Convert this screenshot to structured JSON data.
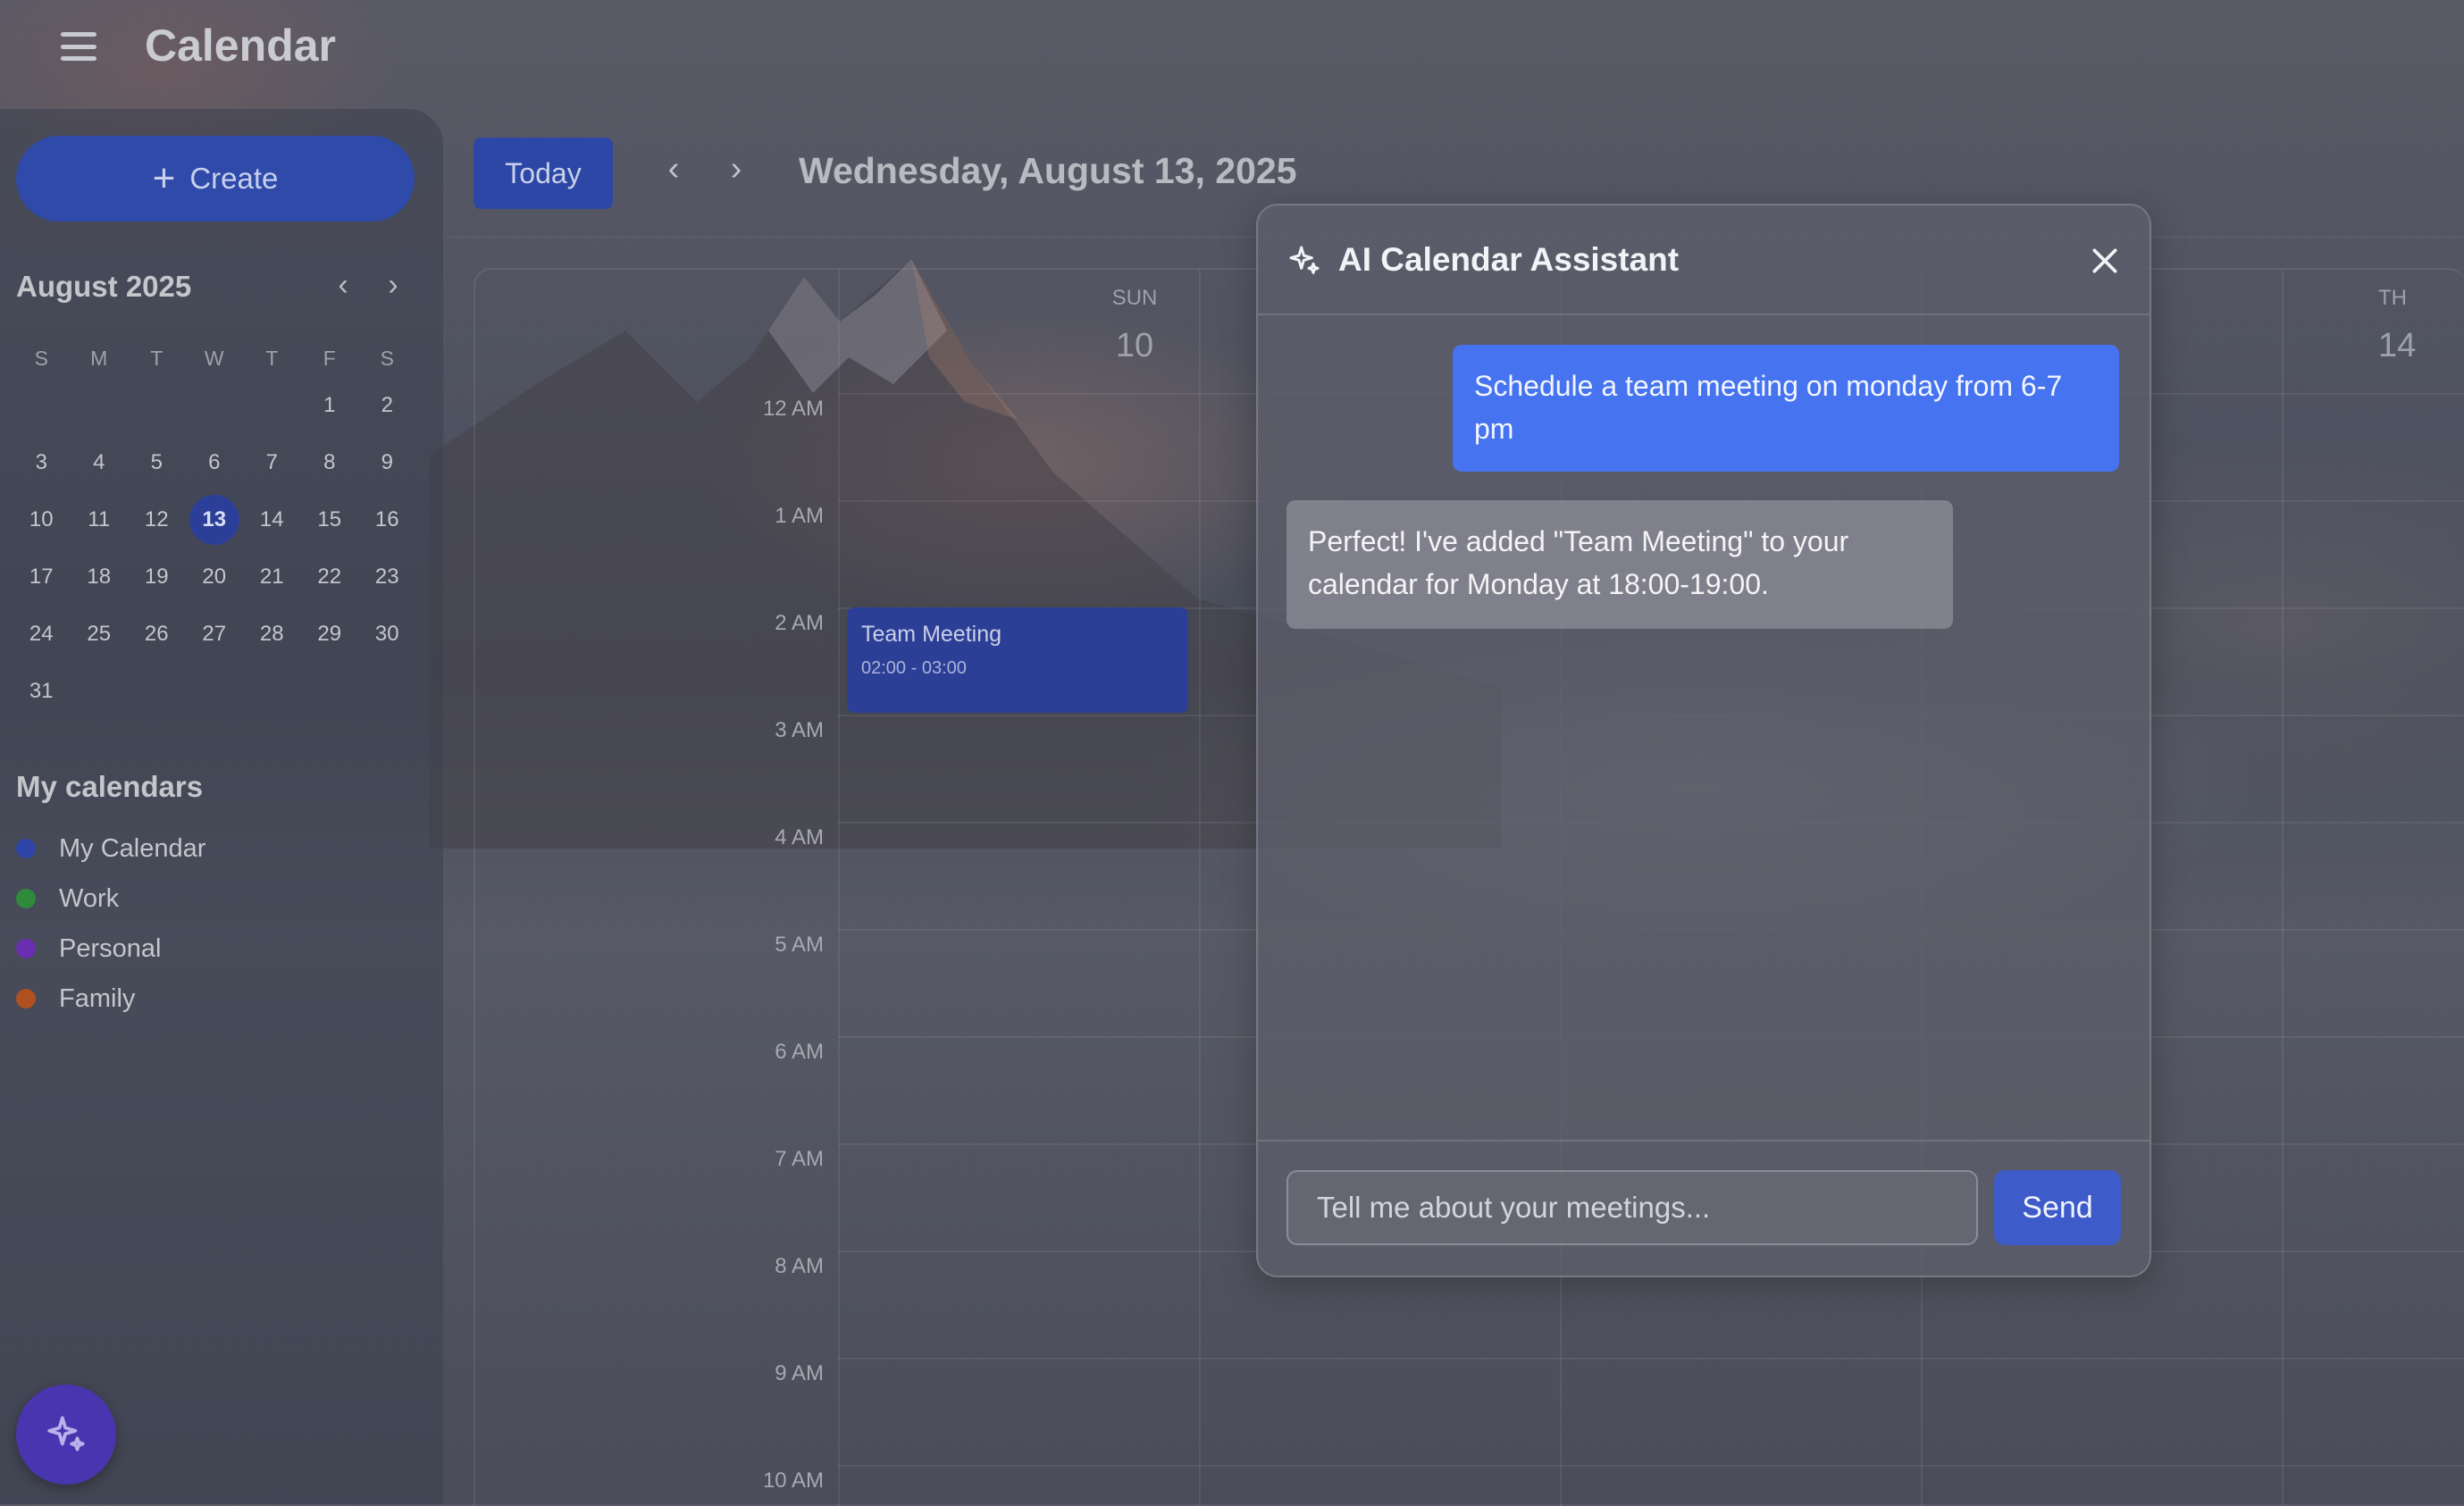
{
  "app": {
    "title": "Calendar"
  },
  "sidebar": {
    "create_label": "Create",
    "mini_calendar": {
      "title": "August 2025",
      "weekdays": [
        "S",
        "M",
        "T",
        "W",
        "T",
        "F",
        "S"
      ],
      "weeks": [
        [
          "",
          "",
          "",
          "",
          "",
          "1",
          "2"
        ],
        [
          "3",
          "4",
          "5",
          "6",
          "7",
          "8",
          "9"
        ],
        [
          "10",
          "11",
          "12",
          "13",
          "14",
          "15",
          "16"
        ],
        [
          "17",
          "18",
          "19",
          "20",
          "21",
          "22",
          "23"
        ],
        [
          "24",
          "25",
          "26",
          "27",
          "28",
          "29",
          "30"
        ],
        [
          "31",
          "",
          "",
          "",
          "",
          "",
          ""
        ]
      ],
      "selected_day": "13"
    },
    "my_calendars_title": "My calendars",
    "calendars": [
      {
        "label": "My Calendar",
        "color": "#2e44a8"
      },
      {
        "label": "Work",
        "color": "#2f8a3c"
      },
      {
        "label": "Personal",
        "color": "#6a2fb0"
      },
      {
        "label": "Family",
        "color": "#b0501e"
      }
    ]
  },
  "toolbar": {
    "today_label": "Today",
    "date_title": "Wednesday, August 13, 2025"
  },
  "grid": {
    "days": [
      {
        "dow": "SUN",
        "num": "10"
      },
      {
        "dow": "TH",
        "num": "14"
      }
    ],
    "hours": [
      "12 AM",
      "1 AM",
      "2 AM",
      "3 AM",
      "4 AM",
      "5 AM",
      "6 AM",
      "7 AM",
      "8 AM",
      "9 AM",
      "10 AM"
    ],
    "event": {
      "title": "Team Meeting",
      "time": "02:00 - 03:00"
    }
  },
  "assistant": {
    "title": "AI Calendar Assistant",
    "messages": [
      {
        "role": "user",
        "text": "Schedule a team meeting on monday from 6-7 pm"
      },
      {
        "role": "assistant",
        "text": "Perfect! I've added \"Team Meeting\" to your calendar for Monday at 18:00-19:00."
      }
    ],
    "input_placeholder": "Tell me about your meetings...",
    "input_value": "",
    "send_label": "Send"
  }
}
